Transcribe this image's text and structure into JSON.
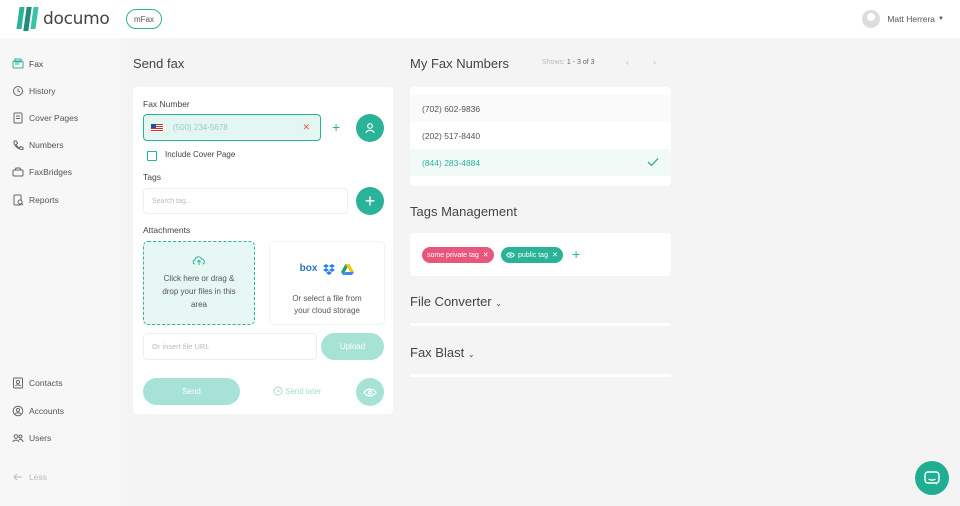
{
  "app": {
    "brand": "documo",
    "product_badge": "mFax",
    "user_name": "Matt Herrera"
  },
  "sidebar": {
    "items": [
      {
        "label": "Fax",
        "icon": "fax-icon"
      },
      {
        "label": "History",
        "icon": "history-icon"
      },
      {
        "label": "Cover Pages",
        "icon": "cover-pages-icon"
      },
      {
        "label": "Numbers",
        "icon": "phone-icon"
      },
      {
        "label": "FaxBridges",
        "icon": "faxbridge-icon"
      },
      {
        "label": "Reports",
        "icon": "reports-icon"
      }
    ],
    "bottom_items": [
      {
        "label": "Contacts",
        "icon": "contacts-icon"
      },
      {
        "label": "Accounts",
        "icon": "accounts-icon"
      },
      {
        "label": "Users",
        "icon": "users-icon"
      }
    ],
    "collapse_label": "Less"
  },
  "send_fax": {
    "title": "Send fax",
    "fax_number_label": "Fax Number",
    "fax_number_placeholder": "(500) 234-5678",
    "include_cover_label": "Include Cover Page",
    "tags_label": "Tags",
    "tags_placeholder": "Search tag...",
    "attachments_label": "Attachments",
    "drop_text": "Click here or drag & drop your files in this area",
    "cloud_text": "Or select a file from your cloud storage",
    "cloud_box_label": "box",
    "url_placeholder": "Or insert file URL",
    "upload_label": "Upload",
    "send_label": "Send",
    "send_later_label": "Send later"
  },
  "fax_numbers": {
    "title": "My Fax Numbers",
    "shows_label": "Shows:",
    "shows_range": "1 - 3 of 3",
    "numbers": [
      {
        "number": "(702) 602-9836",
        "selected": false
      },
      {
        "number": "(202) 517-8440",
        "selected": false
      },
      {
        "number": "(844) 283-4884",
        "selected": true
      }
    ]
  },
  "tags_management": {
    "title": "Tags Management",
    "tags": [
      {
        "label": "some private tag",
        "color": "#e8567b"
      },
      {
        "label": "public tag",
        "color": "#2bb39a"
      }
    ]
  },
  "file_converter": {
    "title": "File Converter"
  },
  "fax_blast": {
    "title": "Fax Blast"
  },
  "colors": {
    "accent": "#2bb39a",
    "accent_light": "#a7e2d6",
    "danger": "#e8567b"
  }
}
